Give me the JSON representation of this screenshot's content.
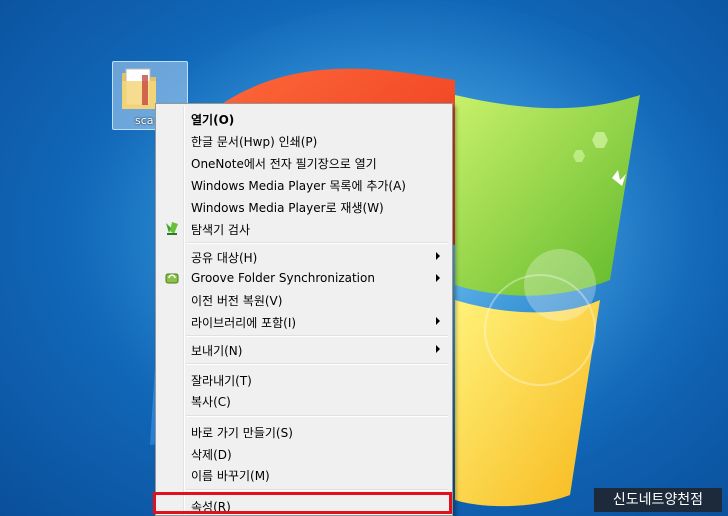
{
  "desktop": {
    "icon_label": "sca",
    "watermark": "신도네트양천점"
  },
  "context_menu": {
    "items": [
      {
        "label": "열기(O)",
        "bold": true
      },
      {
        "label": "한글 문서(Hwp) 인쇄(P)"
      },
      {
        "label": "OneNote에서 전자 필기장으로 열기"
      },
      {
        "label": "Windows Media Player 목록에 추가(A)"
      },
      {
        "label": "Windows Media Player로 재생(W)"
      },
      {
        "label": "탐색기 검사",
        "icon": "scan-icon"
      },
      {
        "label": "공유 대상(H)",
        "submenu": true
      },
      {
        "label": "Groove Folder Synchronization",
        "submenu": true,
        "icon": "groove-icon"
      },
      {
        "label": "이전 버전 복원(V)"
      },
      {
        "label": "라이브러리에 포함(I)",
        "submenu": true
      },
      {
        "label": "보내기(N)",
        "submenu": true
      },
      {
        "label": "잘라내기(T)"
      },
      {
        "label": "복사(C)"
      },
      {
        "label": "바로 가기 만들기(S)"
      },
      {
        "label": "삭제(D)"
      },
      {
        "label": "이름 바꾸기(M)"
      },
      {
        "label": "속성(R)"
      }
    ]
  },
  "colors": {
    "highlight_border": "#e0101d",
    "menu_background": "#f0f0f0"
  }
}
